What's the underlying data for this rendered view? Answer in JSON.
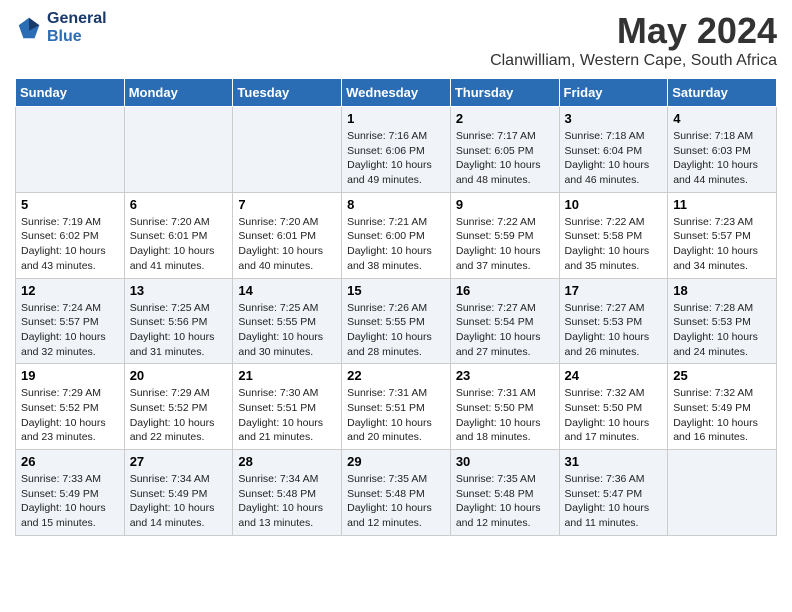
{
  "logo": {
    "line1": "General",
    "line2": "Blue"
  },
  "title": "May 2024",
  "location": "Clanwilliam, Western Cape, South Africa",
  "days_of_week": [
    "Sunday",
    "Monday",
    "Tuesday",
    "Wednesday",
    "Thursday",
    "Friday",
    "Saturday"
  ],
  "weeks": [
    [
      {
        "day": "",
        "info": ""
      },
      {
        "day": "",
        "info": ""
      },
      {
        "day": "",
        "info": ""
      },
      {
        "day": "1",
        "info": "Sunrise: 7:16 AM\nSunset: 6:06 PM\nDaylight: 10 hours\nand 49 minutes."
      },
      {
        "day": "2",
        "info": "Sunrise: 7:17 AM\nSunset: 6:05 PM\nDaylight: 10 hours\nand 48 minutes."
      },
      {
        "day": "3",
        "info": "Sunrise: 7:18 AM\nSunset: 6:04 PM\nDaylight: 10 hours\nand 46 minutes."
      },
      {
        "day": "4",
        "info": "Sunrise: 7:18 AM\nSunset: 6:03 PM\nDaylight: 10 hours\nand 44 minutes."
      }
    ],
    [
      {
        "day": "5",
        "info": "Sunrise: 7:19 AM\nSunset: 6:02 PM\nDaylight: 10 hours\nand 43 minutes."
      },
      {
        "day": "6",
        "info": "Sunrise: 7:20 AM\nSunset: 6:01 PM\nDaylight: 10 hours\nand 41 minutes."
      },
      {
        "day": "7",
        "info": "Sunrise: 7:20 AM\nSunset: 6:01 PM\nDaylight: 10 hours\nand 40 minutes."
      },
      {
        "day": "8",
        "info": "Sunrise: 7:21 AM\nSunset: 6:00 PM\nDaylight: 10 hours\nand 38 minutes."
      },
      {
        "day": "9",
        "info": "Sunrise: 7:22 AM\nSunset: 5:59 PM\nDaylight: 10 hours\nand 37 minutes."
      },
      {
        "day": "10",
        "info": "Sunrise: 7:22 AM\nSunset: 5:58 PM\nDaylight: 10 hours\nand 35 minutes."
      },
      {
        "day": "11",
        "info": "Sunrise: 7:23 AM\nSunset: 5:57 PM\nDaylight: 10 hours\nand 34 minutes."
      }
    ],
    [
      {
        "day": "12",
        "info": "Sunrise: 7:24 AM\nSunset: 5:57 PM\nDaylight: 10 hours\nand 32 minutes."
      },
      {
        "day": "13",
        "info": "Sunrise: 7:25 AM\nSunset: 5:56 PM\nDaylight: 10 hours\nand 31 minutes."
      },
      {
        "day": "14",
        "info": "Sunrise: 7:25 AM\nSunset: 5:55 PM\nDaylight: 10 hours\nand 30 minutes."
      },
      {
        "day": "15",
        "info": "Sunrise: 7:26 AM\nSunset: 5:55 PM\nDaylight: 10 hours\nand 28 minutes."
      },
      {
        "day": "16",
        "info": "Sunrise: 7:27 AM\nSunset: 5:54 PM\nDaylight: 10 hours\nand 27 minutes."
      },
      {
        "day": "17",
        "info": "Sunrise: 7:27 AM\nSunset: 5:53 PM\nDaylight: 10 hours\nand 26 minutes."
      },
      {
        "day": "18",
        "info": "Sunrise: 7:28 AM\nSunset: 5:53 PM\nDaylight: 10 hours\nand 24 minutes."
      }
    ],
    [
      {
        "day": "19",
        "info": "Sunrise: 7:29 AM\nSunset: 5:52 PM\nDaylight: 10 hours\nand 23 minutes."
      },
      {
        "day": "20",
        "info": "Sunrise: 7:29 AM\nSunset: 5:52 PM\nDaylight: 10 hours\nand 22 minutes."
      },
      {
        "day": "21",
        "info": "Sunrise: 7:30 AM\nSunset: 5:51 PM\nDaylight: 10 hours\nand 21 minutes."
      },
      {
        "day": "22",
        "info": "Sunrise: 7:31 AM\nSunset: 5:51 PM\nDaylight: 10 hours\nand 20 minutes."
      },
      {
        "day": "23",
        "info": "Sunrise: 7:31 AM\nSunset: 5:50 PM\nDaylight: 10 hours\nand 18 minutes."
      },
      {
        "day": "24",
        "info": "Sunrise: 7:32 AM\nSunset: 5:50 PM\nDaylight: 10 hours\nand 17 minutes."
      },
      {
        "day": "25",
        "info": "Sunrise: 7:32 AM\nSunset: 5:49 PM\nDaylight: 10 hours\nand 16 minutes."
      }
    ],
    [
      {
        "day": "26",
        "info": "Sunrise: 7:33 AM\nSunset: 5:49 PM\nDaylight: 10 hours\nand 15 minutes."
      },
      {
        "day": "27",
        "info": "Sunrise: 7:34 AM\nSunset: 5:49 PM\nDaylight: 10 hours\nand 14 minutes."
      },
      {
        "day": "28",
        "info": "Sunrise: 7:34 AM\nSunset: 5:48 PM\nDaylight: 10 hours\nand 13 minutes."
      },
      {
        "day": "29",
        "info": "Sunrise: 7:35 AM\nSunset: 5:48 PM\nDaylight: 10 hours\nand 12 minutes."
      },
      {
        "day": "30",
        "info": "Sunrise: 7:35 AM\nSunset: 5:48 PM\nDaylight: 10 hours\nand 12 minutes."
      },
      {
        "day": "31",
        "info": "Sunrise: 7:36 AM\nSunset: 5:47 PM\nDaylight: 10 hours\nand 11 minutes."
      },
      {
        "day": "",
        "info": ""
      }
    ]
  ]
}
